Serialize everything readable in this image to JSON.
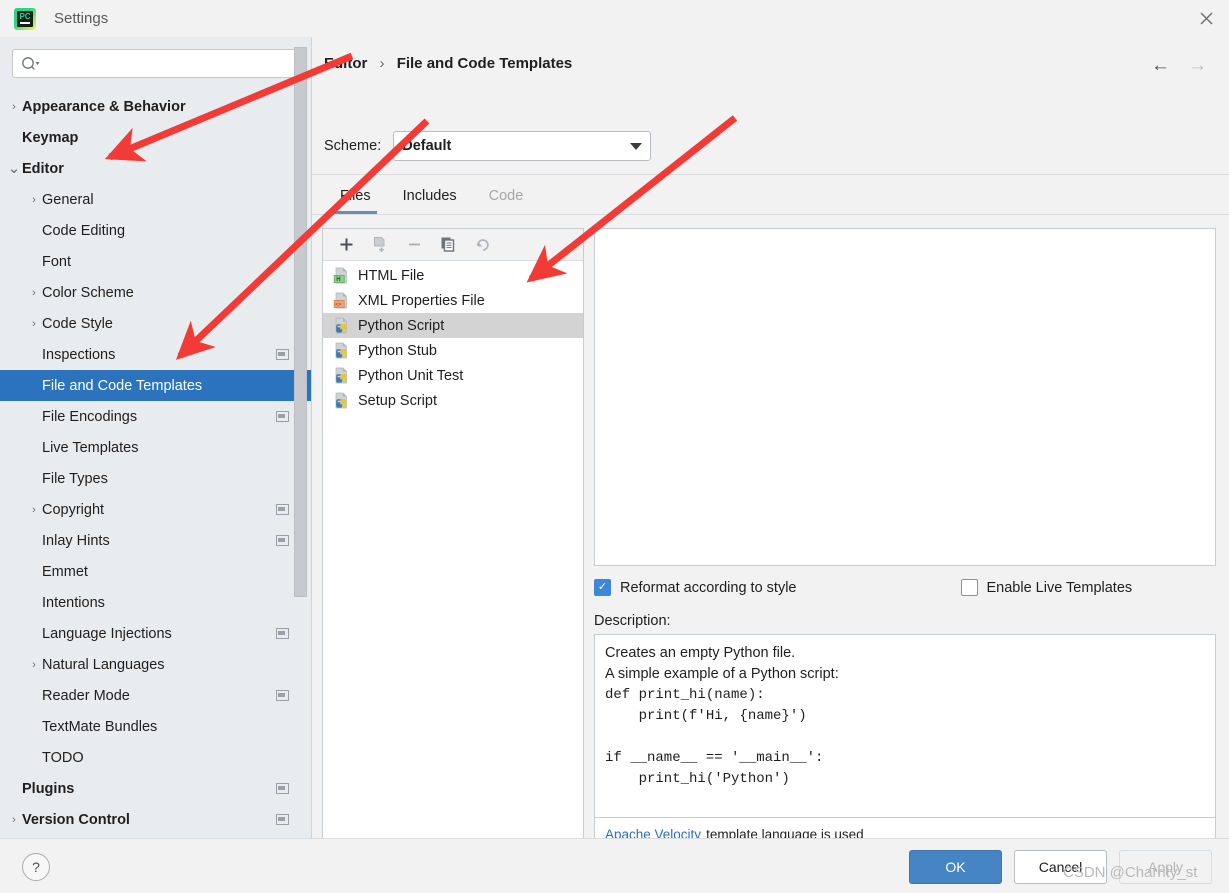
{
  "window": {
    "title": "Settings",
    "app_icon": "pycharm-logo-icon",
    "close_icon": "close-icon"
  },
  "sidebar": {
    "search": {
      "placeholder": "",
      "value": "",
      "icon": "search-icon"
    },
    "items": [
      {
        "label": "Appearance & Behavior",
        "level": 0,
        "expandable": true,
        "expanded": false,
        "bold": true,
        "selected": false,
        "badge": false
      },
      {
        "label": "Keymap",
        "level": 0,
        "expandable": false,
        "expanded": false,
        "bold": true,
        "selected": false,
        "badge": false
      },
      {
        "label": "Editor",
        "level": 0,
        "expandable": true,
        "expanded": true,
        "bold": true,
        "selected": false,
        "badge": false
      },
      {
        "label": "General",
        "level": 1,
        "expandable": true,
        "expanded": false,
        "bold": false,
        "selected": false,
        "badge": false
      },
      {
        "label": "Code Editing",
        "level": 1,
        "expandable": false,
        "expanded": false,
        "bold": false,
        "selected": false,
        "badge": false
      },
      {
        "label": "Font",
        "level": 1,
        "expandable": false,
        "expanded": false,
        "bold": false,
        "selected": false,
        "badge": false
      },
      {
        "label": "Color Scheme",
        "level": 1,
        "expandable": true,
        "expanded": false,
        "bold": false,
        "selected": false,
        "badge": false
      },
      {
        "label": "Code Style",
        "level": 1,
        "expandable": true,
        "expanded": false,
        "bold": false,
        "selected": false,
        "badge": false
      },
      {
        "label": "Inspections",
        "level": 1,
        "expandable": false,
        "expanded": false,
        "bold": false,
        "selected": false,
        "badge": true
      },
      {
        "label": "File and Code Templates",
        "level": 1,
        "expandable": false,
        "expanded": false,
        "bold": false,
        "selected": true,
        "badge": false
      },
      {
        "label": "File Encodings",
        "level": 1,
        "expandable": false,
        "expanded": false,
        "bold": false,
        "selected": false,
        "badge": true
      },
      {
        "label": "Live Templates",
        "level": 1,
        "expandable": false,
        "expanded": false,
        "bold": false,
        "selected": false,
        "badge": false
      },
      {
        "label": "File Types",
        "level": 1,
        "expandable": false,
        "expanded": false,
        "bold": false,
        "selected": false,
        "badge": false
      },
      {
        "label": "Copyright",
        "level": 1,
        "expandable": true,
        "expanded": false,
        "bold": false,
        "selected": false,
        "badge": true
      },
      {
        "label": "Inlay Hints",
        "level": 1,
        "expandable": false,
        "expanded": false,
        "bold": false,
        "selected": false,
        "badge": true
      },
      {
        "label": "Emmet",
        "level": 1,
        "expandable": false,
        "expanded": false,
        "bold": false,
        "selected": false,
        "badge": false
      },
      {
        "label": "Intentions",
        "level": 1,
        "expandable": false,
        "expanded": false,
        "bold": false,
        "selected": false,
        "badge": false
      },
      {
        "label": "Language Injections",
        "level": 1,
        "expandable": false,
        "expanded": false,
        "bold": false,
        "selected": false,
        "badge": true
      },
      {
        "label": "Natural Languages",
        "level": 1,
        "expandable": true,
        "expanded": false,
        "bold": false,
        "selected": false,
        "badge": false
      },
      {
        "label": "Reader Mode",
        "level": 1,
        "expandable": false,
        "expanded": false,
        "bold": false,
        "selected": false,
        "badge": true
      },
      {
        "label": "TextMate Bundles",
        "level": 1,
        "expandable": false,
        "expanded": false,
        "bold": false,
        "selected": false,
        "badge": false
      },
      {
        "label": "TODO",
        "level": 1,
        "expandable": false,
        "expanded": false,
        "bold": false,
        "selected": false,
        "badge": false
      },
      {
        "label": "Plugins",
        "level": 0,
        "expandable": false,
        "expanded": false,
        "bold": true,
        "selected": false,
        "badge": true
      },
      {
        "label": "Version Control",
        "level": 0,
        "expandable": true,
        "expanded": false,
        "bold": true,
        "selected": false,
        "badge": true
      }
    ]
  },
  "header": {
    "breadcrumb": [
      "Editor",
      "File and Code Templates"
    ],
    "separator": "›",
    "back_icon": "arrow-left-icon",
    "forward_icon": "arrow-right-icon"
  },
  "scheme": {
    "label": "Scheme:",
    "value": "Default",
    "caret_icon": "chevron-down-icon"
  },
  "tabs": [
    {
      "label": "Files",
      "active": true,
      "disabled": false
    },
    {
      "label": "Includes",
      "active": false,
      "disabled": false
    },
    {
      "label": "Code",
      "active": false,
      "disabled": true
    }
  ],
  "list_toolbar": [
    {
      "name": "add-icon",
      "label": "+",
      "enabled": true
    },
    {
      "name": "add-from-file-icon",
      "label": "",
      "enabled": false
    },
    {
      "name": "remove-icon",
      "label": "−",
      "enabled": false
    },
    {
      "name": "copy-icon",
      "label": "",
      "enabled": true
    },
    {
      "name": "reset-icon",
      "label": "↶",
      "enabled": false
    }
  ],
  "templates": [
    {
      "label": "HTML File",
      "icon": "html-file-icon",
      "selected": false
    },
    {
      "label": "XML Properties File",
      "icon": "xml-properties-file-icon",
      "selected": false
    },
    {
      "label": "Python Script",
      "icon": "python-file-icon",
      "selected": true
    },
    {
      "label": "Python Stub",
      "icon": "python-file-icon",
      "selected": false
    },
    {
      "label": "Python Unit Test",
      "icon": "python-file-icon",
      "selected": false
    },
    {
      "label": "Setup Script",
      "icon": "python-file-icon",
      "selected": false
    }
  ],
  "editor": {
    "content": ""
  },
  "options": {
    "reformat": {
      "label": "Reformat according to style",
      "checked": true,
      "check_icon": "checkmark-icon"
    },
    "live_templates": {
      "label": "Enable Live Templates",
      "checked": false
    }
  },
  "description": {
    "label": "Description:",
    "line1": "Creates an empty Python file.",
    "line2": "A simple example of a Python script:",
    "code1": "def print_hi(name):\n    print(f'Hi, {name}')",
    "code2": "if __name__ == '__main__':\n    print_hi('Python')",
    "footer_link": "Apache Velocity",
    "footer_text": "template language is used"
  },
  "footer": {
    "help_label": "?",
    "ok_label": "OK",
    "cancel_label": "Cancel",
    "apply_label": "Apply",
    "watermark": "CSDN @Charrity_st"
  },
  "colors": {
    "selection_blue": "#2b74bd",
    "accent_blue": "#4585c4",
    "annotation_red": "#f23b36",
    "sidebar_bg": "#e8ecef",
    "panel_bg": "#f2f2f2",
    "link_blue": "#2a6fc4"
  }
}
